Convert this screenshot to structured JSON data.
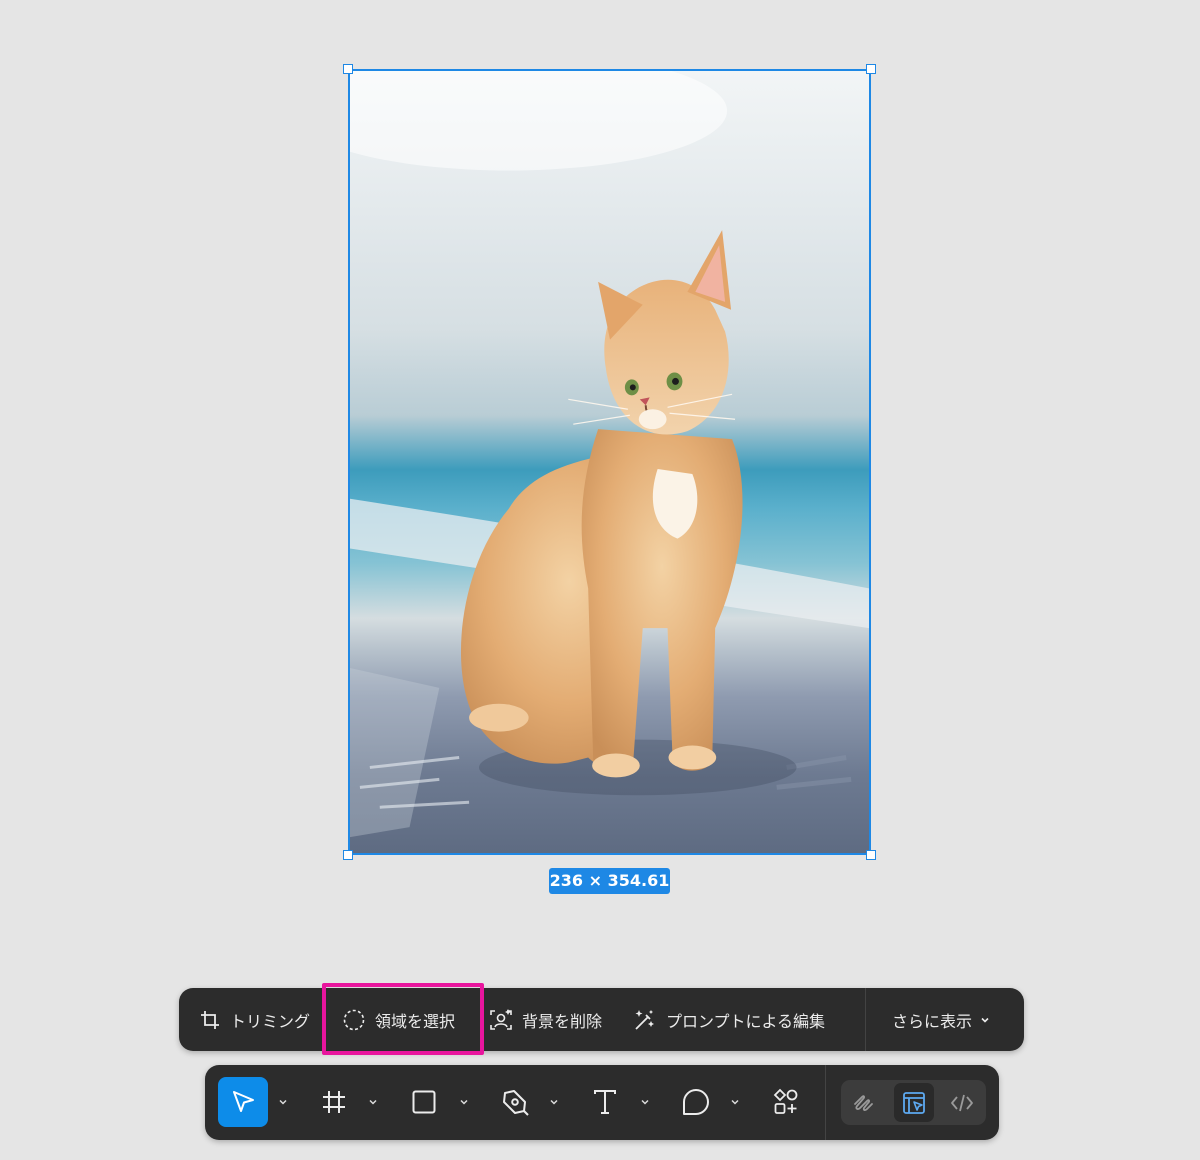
{
  "canvas": {
    "selection_size": "236 × 354.61"
  },
  "context_toolbar": {
    "crop_label": "トリミング",
    "select_area_label": "領域を選択",
    "remove_bg_label": "背景を削除",
    "prompt_edit_label": "プロンプトによる編集",
    "more_label": "さらに表示"
  },
  "main_toolbar": {
    "tools": [
      "move-tool",
      "frame-tool",
      "shape-tool",
      "pen-tool",
      "text-tool",
      "comment-tool",
      "actions-tool"
    ],
    "active_tool": "move-tool",
    "modes": [
      "draw-mode",
      "design-mode",
      "dev-mode"
    ],
    "active_mode": "design-mode"
  },
  "colors": {
    "accent": "#1e88e5",
    "active_tool": "#0d8ce9",
    "toolbar_bg": "#2c2c2c",
    "highlight": "#e8159d",
    "canvas_bg": "#e5e5e5"
  }
}
